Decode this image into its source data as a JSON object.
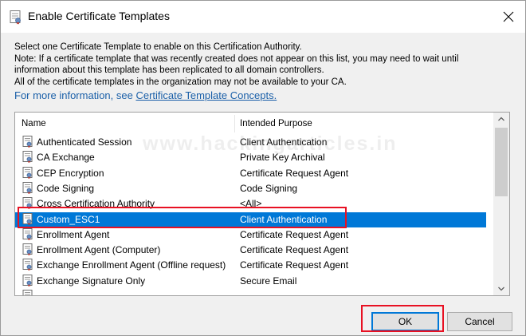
{
  "window": {
    "title": "Enable Certificate Templates",
    "close_symbol": "×"
  },
  "intro": {
    "line1": "Select one Certificate Template to enable on this Certification Authority.",
    "line2": "Note: If a certificate template that was recently created does not appear on this list, you may need to wait until",
    "line3": "information about this template has been replicated to all domain controllers.",
    "line4": "All of the certificate templates in the organization may not be available to your CA.",
    "more_prefix": "For more information, see ",
    "more_link": "Certificate Template Concepts."
  },
  "list": {
    "columns": {
      "name": "Name",
      "purpose": "Intended Purpose"
    },
    "rows": [
      {
        "name": "Authenticated Session",
        "purpose": "Client Authentication"
      },
      {
        "name": "CA Exchange",
        "purpose": "Private Key Archival"
      },
      {
        "name": "CEP Encryption",
        "purpose": "Certificate Request Agent"
      },
      {
        "name": "Code Signing",
        "purpose": "Code Signing"
      },
      {
        "name": "Cross Certification Authority",
        "purpose": "<All>"
      },
      {
        "name": "Custom_ESC1",
        "purpose": "Client Authentication",
        "selected": true
      },
      {
        "name": "Enrollment Agent",
        "purpose": "Certificate Request Agent"
      },
      {
        "name": "Enrollment Agent (Computer)",
        "purpose": "Certificate Request Agent"
      },
      {
        "name": "Exchange Enrollment Agent (Offline request)",
        "purpose": "Certificate Request Agent"
      },
      {
        "name": "Exchange Signature Only",
        "purpose": "Secure Email"
      },
      {
        "name": "",
        "purpose": ""
      }
    ],
    "watermark": "www.hackingarticles.in",
    "selection_color": "#0078d7"
  },
  "buttons": {
    "ok": "OK",
    "cancel": "Cancel"
  },
  "annotation_color": "#e81123"
}
